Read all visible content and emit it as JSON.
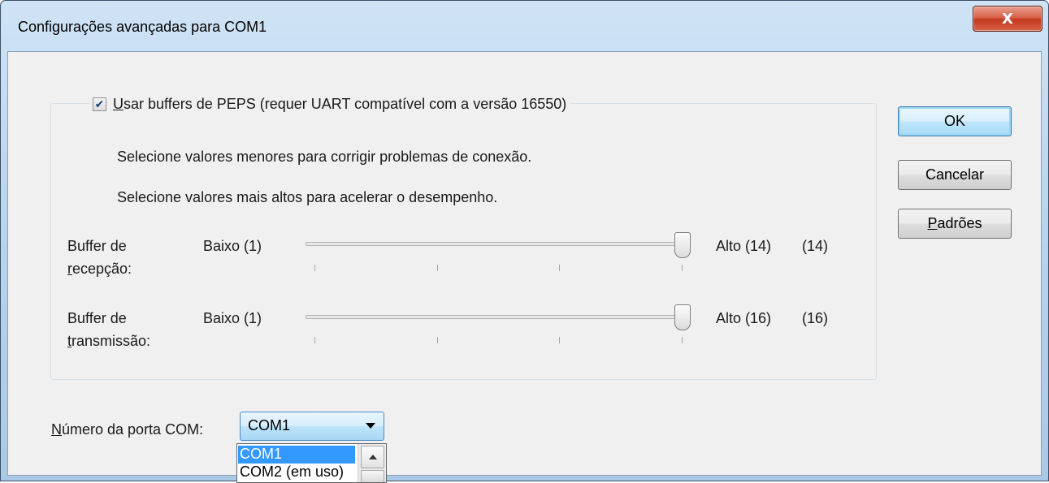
{
  "window": {
    "title": "Configurações avançadas para COM1",
    "close_label": "X"
  },
  "fifo": {
    "checked": true,
    "label_first": "U",
    "label_rest": "sar buffers de PEPS (requer UART compatível com a versão 16550)",
    "hint_lower": "Selecione valores menores para corrigir problemas de conexão.",
    "hint_higher": "Selecione valores mais altos para acelerar o desempenho."
  },
  "receive": {
    "label_line1": "Buffer de",
    "label_key": "r",
    "label_rest": "ecepção:",
    "low": "Baixo (1)",
    "high": "Alto (14)",
    "current": "(14)",
    "level": 1.0
  },
  "transmit": {
    "label_line1": "Buffer de",
    "label_key": "t",
    "label_rest": "ransmissão:",
    "low": "Baixo (1)",
    "high": "Alto (16)",
    "current": "(16)",
    "level": 1.0
  },
  "buttons": {
    "ok": "OK",
    "cancel": "Cancelar",
    "defaults_key": "P",
    "defaults_rest": "adrões"
  },
  "port": {
    "label_key": "N",
    "label_rest": "úmero da porta COM:",
    "selected": "COM1",
    "options": [
      "COM1",
      "COM2 (em uso)"
    ]
  }
}
